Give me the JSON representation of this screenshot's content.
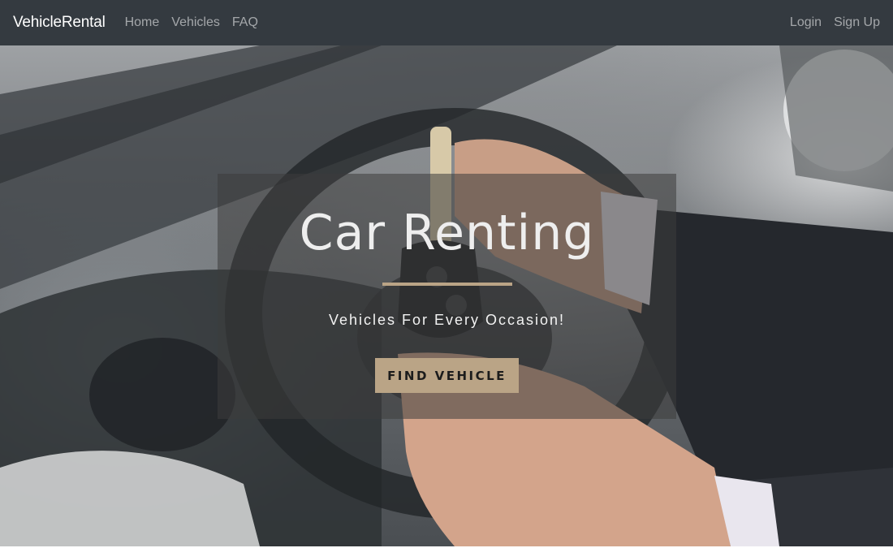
{
  "navbar": {
    "brand": "VehicleRental",
    "links": [
      {
        "label": "Home"
      },
      {
        "label": "Vehicles"
      },
      {
        "label": "FAQ"
      }
    ],
    "auth": [
      {
        "label": "Login"
      },
      {
        "label": "Sign Up"
      }
    ]
  },
  "hero": {
    "title": "Car Renting",
    "subtitle": "Vehicles For Every Occasion!",
    "cta_label": "FIND VEHICLE",
    "background_image": "car-interior-key-photo"
  },
  "colors": {
    "navbar_bg": "#343a40",
    "accent": "#baa486",
    "nav_link": "rgba(255,255,255,0.55)"
  }
}
